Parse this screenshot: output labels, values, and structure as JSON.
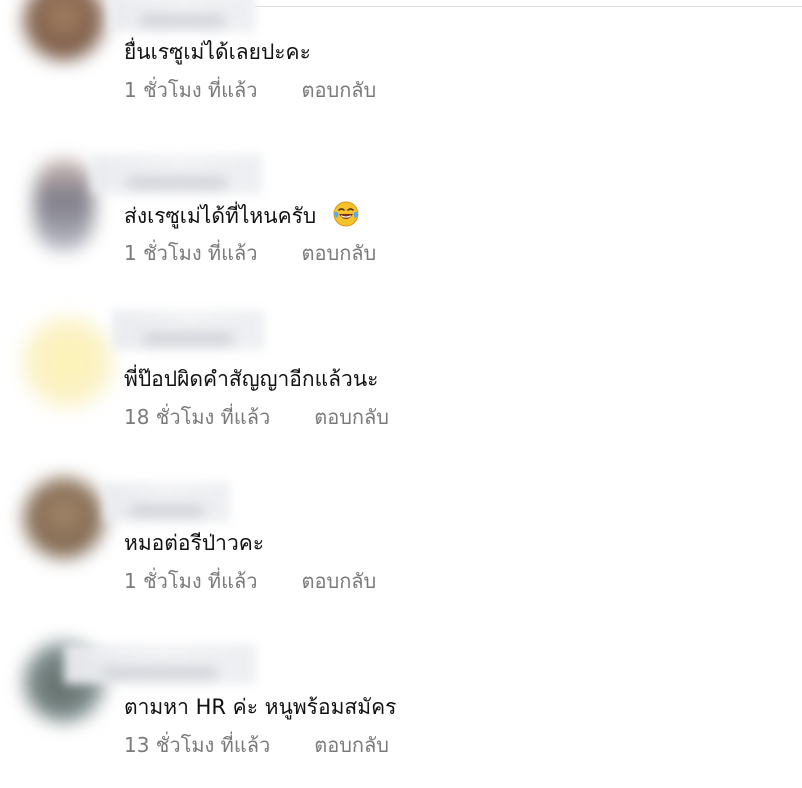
{
  "comments": [
    {
      "text": "ยื่นเรซูเม่ได้เลยปะคะ",
      "time": "1 ชั่วโมง ที่แล้ว",
      "reply_label": "ตอบกลับ",
      "avatar_color": "#8a6a54"
    },
    {
      "text": "ส่งเรซูเม่ได้ที่ไหนครับ",
      "emoji": "face-with-tears-of-joy-icon",
      "time": "1 ชั่วโมง ที่แล้ว",
      "reply_label": "ตอบกลับ",
      "avatar_color": "#9a97a0"
    },
    {
      "text": "พี่ป๊อปผิดคำสัญญาอีกแล้วนะ",
      "time": "18 ชั่วโมง ที่แล้ว",
      "reply_label": "ตอบกลับ",
      "avatar_color": "#fbf1b8"
    },
    {
      "text": "หมอต่อรีป่าวคะ",
      "time": "1 ชั่วโมง ที่แล้ว",
      "reply_label": "ตอบกลับ",
      "avatar_color": "#8c7358"
    },
    {
      "text": "ตามหา HR ค่ะ หนูพร้อมสมัคร",
      "time": "13 ชั่วโมง ที่แล้ว",
      "reply_label": "ตอบกลับ",
      "avatar_color": "#6f7a78"
    }
  ]
}
